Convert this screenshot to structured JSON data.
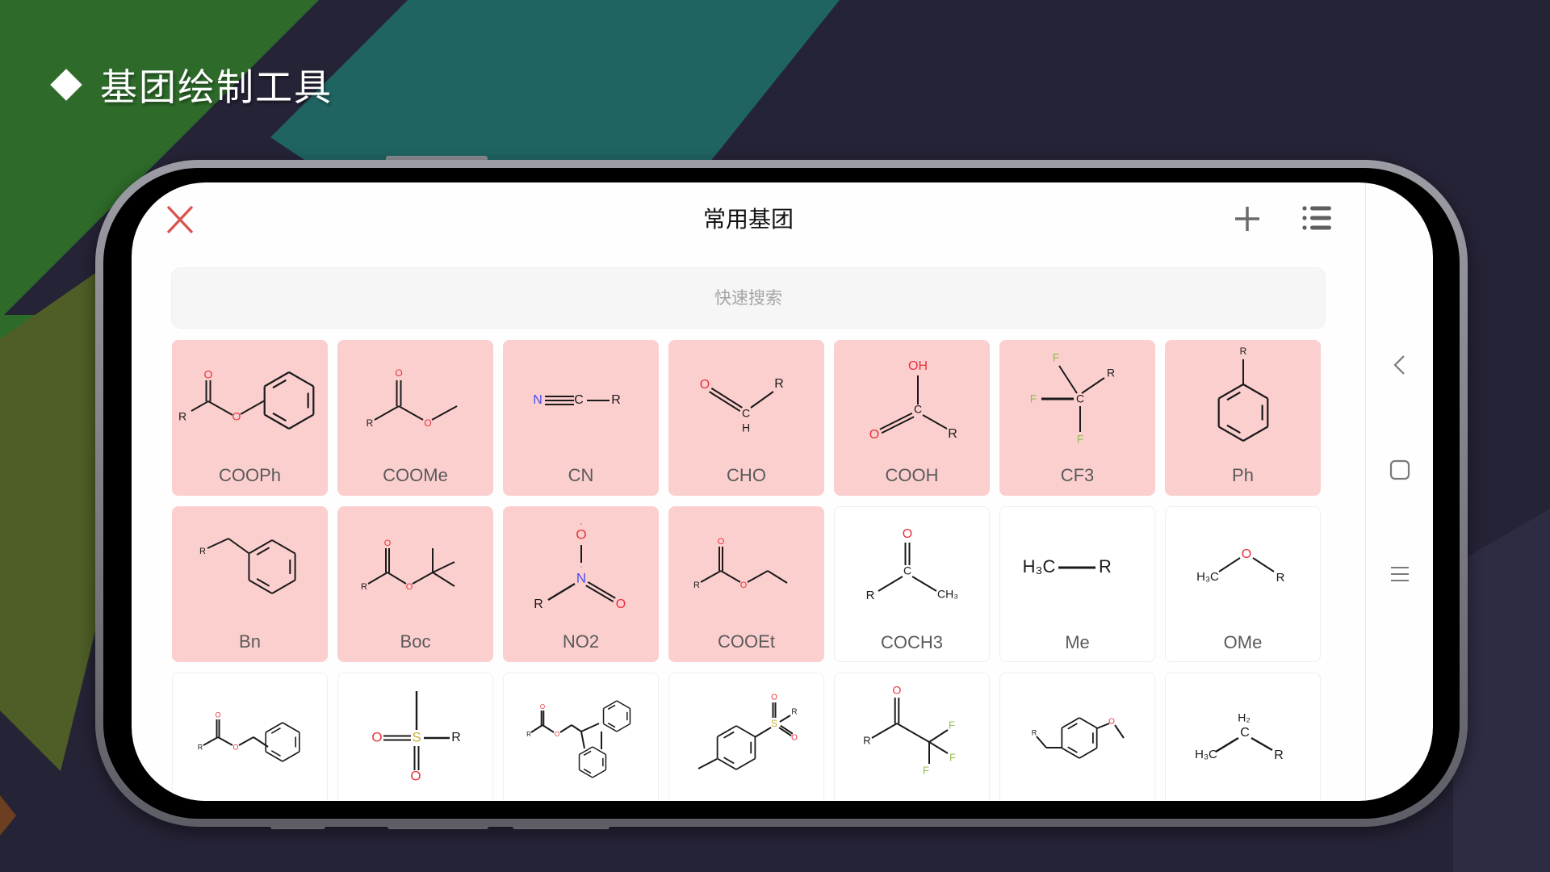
{
  "slide": {
    "title": "基团绘制工具"
  },
  "colors": {
    "accent_close": "#d9534f",
    "favorite_tile": "#fccfcf",
    "oxygen": "#e8323c",
    "nitrogen": "#4b4bf0",
    "fluorine": "#8fbf4f",
    "sulfur": "#c8b030",
    "bond": "#1a1a1a"
  },
  "header": {
    "title": "常用基团",
    "close_icon": "close-icon",
    "add_icon": "plus-icon",
    "list_icon": "list-icon"
  },
  "search": {
    "placeholder": "快速搜索",
    "value": ""
  },
  "system_nav": {
    "items": [
      "back-icon",
      "home-icon",
      "recents-icon"
    ]
  },
  "groups": [
    {
      "label": "COOPh",
      "favorite": true,
      "structure": "COOPh"
    },
    {
      "label": "COOMe",
      "favorite": true,
      "structure": "COOMe"
    },
    {
      "label": "CN",
      "favorite": true,
      "structure": "CN"
    },
    {
      "label": "CHO",
      "favorite": true,
      "structure": "CHO"
    },
    {
      "label": "COOH",
      "favorite": true,
      "structure": "COOH"
    },
    {
      "label": "CF3",
      "favorite": true,
      "structure": "CF3"
    },
    {
      "label": "Ph",
      "favorite": true,
      "structure": "Ph"
    },
    {
      "label": "Bn",
      "favorite": true,
      "structure": "Bn"
    },
    {
      "label": "Boc",
      "favorite": true,
      "structure": "Boc"
    },
    {
      "label": "NO2",
      "favorite": true,
      "structure": "NO2"
    },
    {
      "label": "COOEt",
      "favorite": true,
      "structure": "COOEt"
    },
    {
      "label": "COCH3",
      "favorite": false,
      "structure": "COCH3"
    },
    {
      "label": "Me",
      "favorite": false,
      "structure": "Me"
    },
    {
      "label": "OMe",
      "favorite": false,
      "structure": "OMe"
    },
    {
      "label": "",
      "favorite": false,
      "structure": "Cbz"
    },
    {
      "label": "",
      "favorite": false,
      "structure": "Ms"
    },
    {
      "label": "",
      "favorite": false,
      "structure": "Fmoc"
    },
    {
      "label": "",
      "favorite": false,
      "structure": "Ts"
    },
    {
      "label": "",
      "favorite": false,
      "structure": "TFA"
    },
    {
      "label": "",
      "favorite": false,
      "structure": "PMB"
    },
    {
      "label": "",
      "favorite": false,
      "structure": "Et"
    }
  ]
}
